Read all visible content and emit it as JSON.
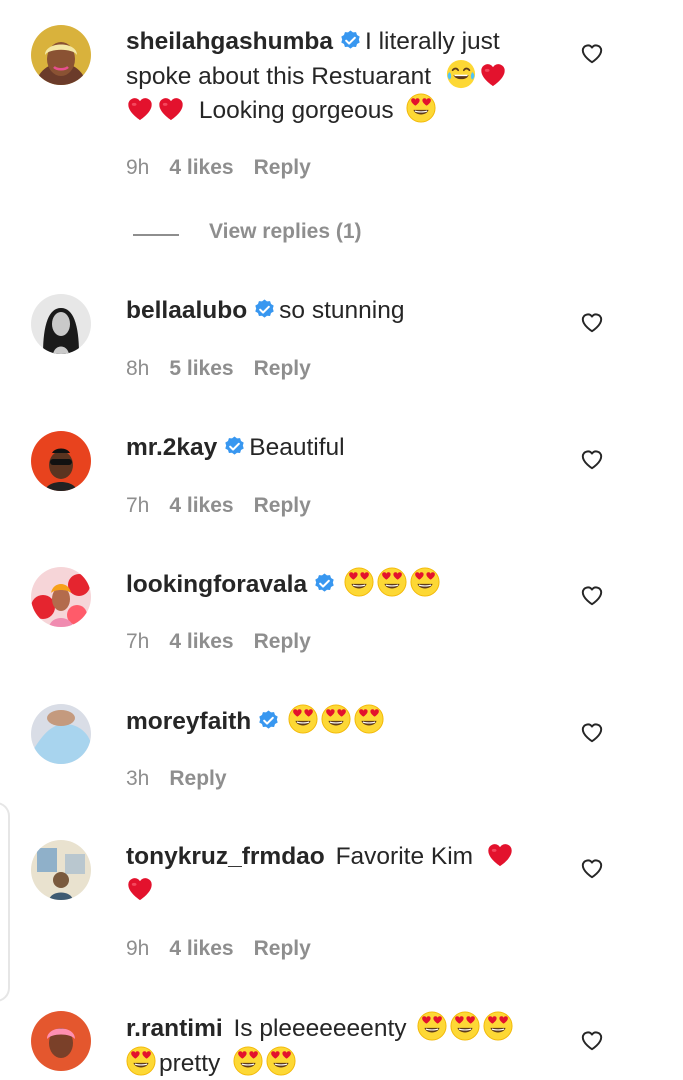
{
  "colors": {
    "verified": "#3897f0",
    "heart_red": "#e3122d",
    "meta_gray": "#8e8e8e",
    "text": "#262626"
  },
  "comments": [
    {
      "username": "sheilahgashumba",
      "verified": true,
      "line1": "I literally just",
      "line2": "spoke about this Restuarant",
      "line3": "Looking gorgeous",
      "time": "9h",
      "likes": "4 likes",
      "reply": "Reply",
      "view_replies": "View replies (1)"
    },
    {
      "username": "bellaalubo",
      "verified": true,
      "text": "so stunning",
      "time": "8h",
      "likes": "5 likes",
      "reply": "Reply"
    },
    {
      "username": "mr.2kay",
      "verified": true,
      "text": "Beautiful",
      "time": "7h",
      "likes": "4 likes",
      "reply": "Reply"
    },
    {
      "username": "lookingforavala",
      "verified": true,
      "emojis": [
        "heart-eyes-emoji",
        "heart-eyes-emoji",
        "heart-eyes-emoji"
      ],
      "time": "7h",
      "likes": "4 likes",
      "reply": "Reply"
    },
    {
      "username": "moreyfaith",
      "verified": true,
      "emojis": [
        "heart-eyes-emoji",
        "heart-eyes-emoji",
        "heart-eyes-emoji"
      ],
      "time": "3h",
      "reply": "Reply"
    },
    {
      "username": "tonykruz_frmdao",
      "verified": false,
      "text": "Favorite Kim",
      "time": "9h",
      "likes": "4 likes",
      "reply": "Reply"
    },
    {
      "username": "r.rantimi",
      "verified": false,
      "text": "Is pleeeeeeenty",
      "text2": "pretty"
    }
  ]
}
